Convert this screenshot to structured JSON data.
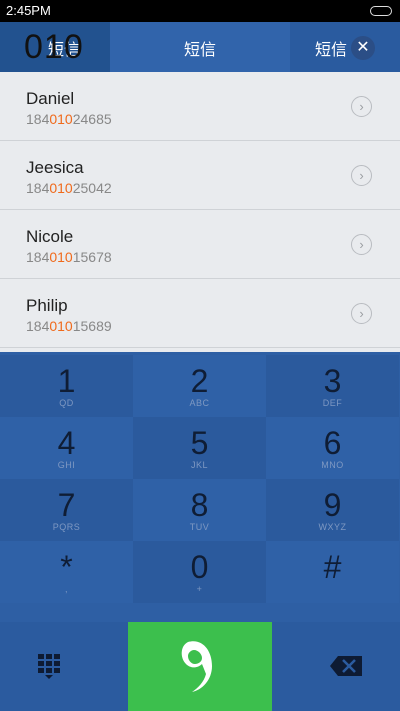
{
  "status": {
    "time": "2:45PM"
  },
  "header": {
    "dialed_number": "010",
    "tabs": [
      "短信",
      "短信",
      "短信"
    ]
  },
  "contacts": [
    {
      "name": "Daniel",
      "number_prefix": "184",
      "number_match": "010",
      "number_suffix": "24685"
    },
    {
      "name": "Jeesica",
      "number_prefix": "184",
      "number_match": "010",
      "number_suffix": "25042"
    },
    {
      "name": "Nicole",
      "number_prefix": "184",
      "number_match": "010",
      "number_suffix": "15678"
    },
    {
      "name": "Philip",
      "number_prefix": "184",
      "number_match": "010",
      "number_suffix": "15689"
    }
  ],
  "keypad": [
    {
      "digit": "1",
      "letters": "QD"
    },
    {
      "digit": "2",
      "letters": "ABC"
    },
    {
      "digit": "3",
      "letters": "DEF"
    },
    {
      "digit": "4",
      "letters": "GHI"
    },
    {
      "digit": "5",
      "letters": "JKL"
    },
    {
      "digit": "6",
      "letters": "MNO"
    },
    {
      "digit": "7",
      "letters": "PQRS"
    },
    {
      "digit": "8",
      "letters": "TUV"
    },
    {
      "digit": "9",
      "letters": "WXYZ"
    },
    {
      "digit": "*",
      "letters": ","
    },
    {
      "digit": "0",
      "letters": "+"
    },
    {
      "digit": "#",
      "letters": ""
    }
  ],
  "icons": {
    "dialpad_toggle": "dialpad-grid-icon",
    "call": "call-icon",
    "backspace": "backspace-icon",
    "clear": "clear-icon",
    "contact_detail": "chevron-right-icon"
  },
  "colors": {
    "accent_blue": "#2e5fa4",
    "highlight_orange": "#f06a1c",
    "call_green": "#3cbf4d"
  }
}
